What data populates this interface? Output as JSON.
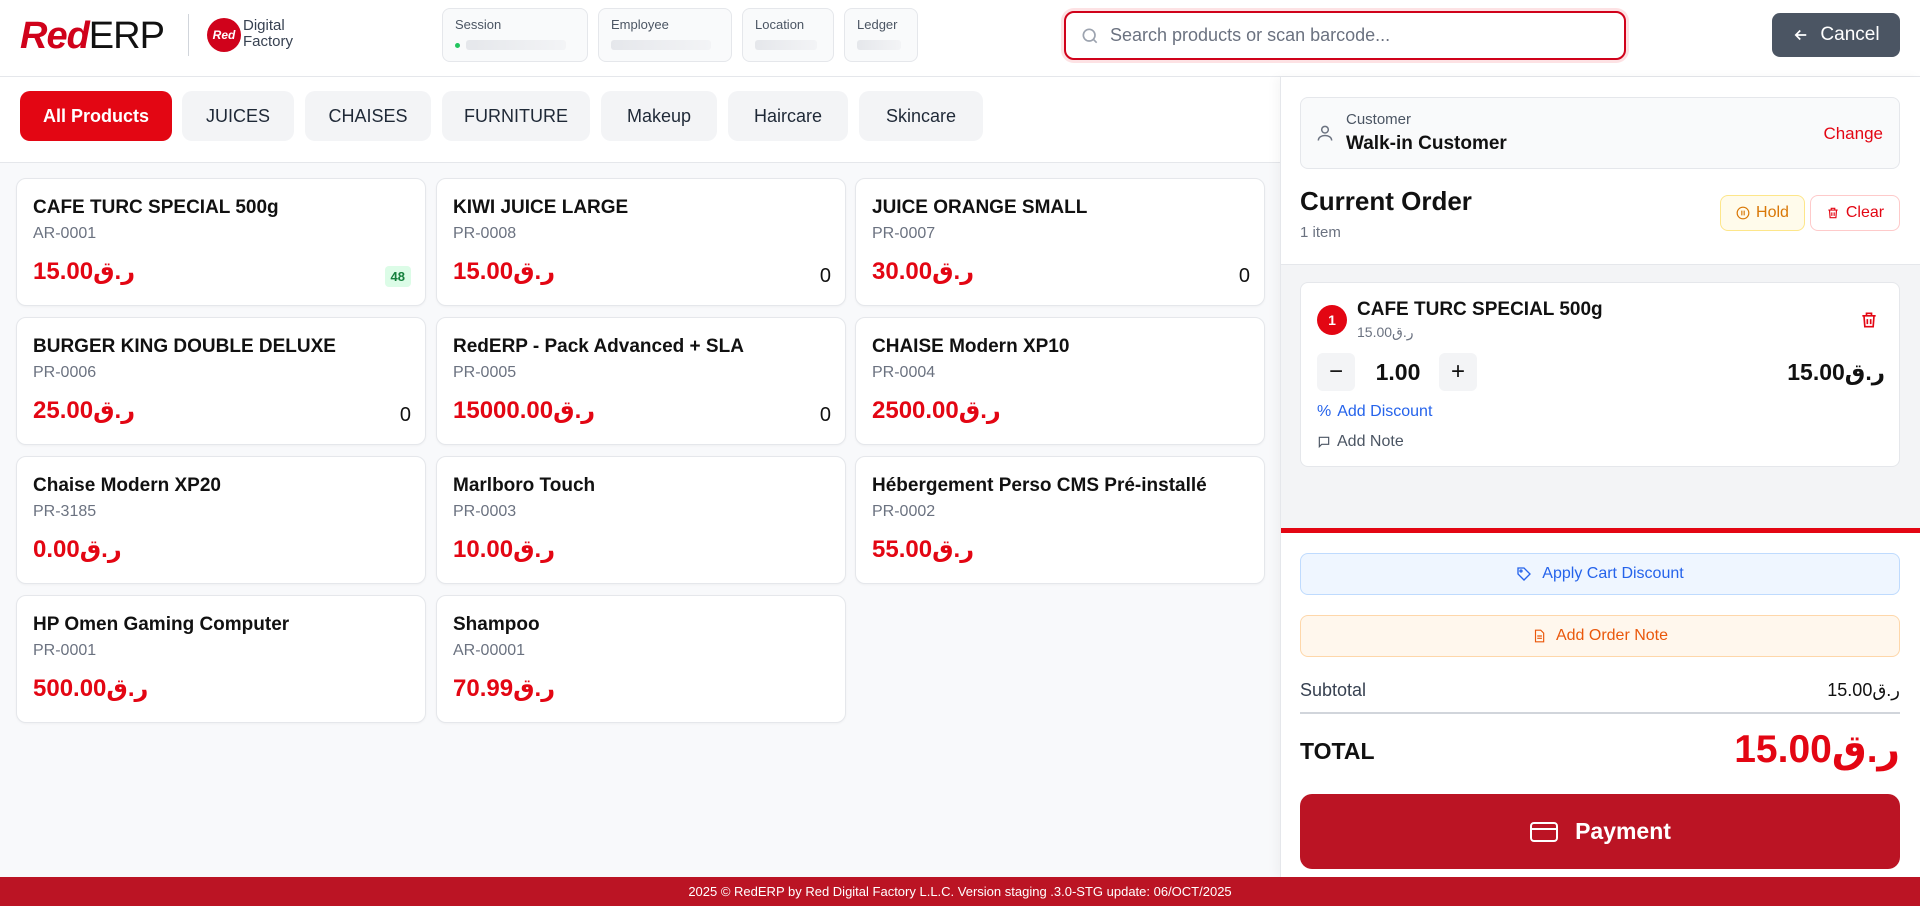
{
  "brand": {
    "logo_red": "Red",
    "logo_erp": "ERP",
    "partner_badge": "Red",
    "partner_line1": "Digital",
    "partner_line2": "Factory"
  },
  "header": {
    "session_label": "Session",
    "employee_label": "Employee",
    "location_label": "Location",
    "ledger_label": "Ledger",
    "search_placeholder": "Search products or scan barcode...",
    "cancel_label": "Cancel"
  },
  "categories": [
    "All Products",
    "JUICES",
    "CHAISES",
    "FURNITURE",
    "Makeup",
    "Haircare",
    "Skincare"
  ],
  "active_category": "All Products",
  "products": [
    {
      "name": "CAFE TURC SPECIAL 500g",
      "code": "AR-0001",
      "price": "15.00ر.ق",
      "stock": "48"
    },
    {
      "name": "KIWI JUICE LARGE",
      "code": "PR-0008",
      "price": "15.00ر.ق",
      "stock": "0"
    },
    {
      "name": "JUICE ORANGE SMALL",
      "code": "PR-0007",
      "price": "30.00ر.ق",
      "stock": "0"
    },
    {
      "name": "BURGER KING DOUBLE DELUXE",
      "code": "PR-0006",
      "price": "25.00ر.ق",
      "stock": "0"
    },
    {
      "name": "RedERP - Pack Advanced + SLA",
      "code": "PR-0005",
      "price": "15000.00ر.ق",
      "stock": "0"
    },
    {
      "name": "CHAISE Modern XP10",
      "code": "PR-0004",
      "price": "2500.00ر.ق",
      "stock": ""
    },
    {
      "name": "Chaise Modern XP20",
      "code": "PR-3185",
      "price": "0.00ر.ق",
      "stock": ""
    },
    {
      "name": "Marlboro Touch",
      "code": "PR-0003",
      "price": "10.00ر.ق",
      "stock": ""
    },
    {
      "name": "Hébergement Perso CMS Pré-installé",
      "code": "PR-0002",
      "price": "55.00ر.ق",
      "stock": ""
    },
    {
      "name": "HP Omen Gaming Computer",
      "code": "PR-0001",
      "price": "500.00ر.ق",
      "stock": ""
    },
    {
      "name": "Shampoo",
      "code": "AR-00001",
      "price": "70.99ر.ق",
      "stock": ""
    }
  ],
  "customer": {
    "label": "Customer",
    "name": "Walk-in Customer",
    "change_label": "Change"
  },
  "order": {
    "title": "Current Order",
    "count": "1 item",
    "hold_label": "Hold",
    "clear_label": "Clear",
    "items": [
      {
        "index": "1",
        "name": "CAFE TURC SPECIAL 500g",
        "unit_price": "15.00ر.ق",
        "quantity": "1.00",
        "line_total": "15.00ر.ق",
        "discount_label": "Add Discount",
        "note_label": "Add Note"
      }
    ],
    "cart_discount_label": "Apply Cart Discount",
    "order_note_label": "Add Order Note",
    "subtotal_label": "Subtotal",
    "subtotal": "15.00ر.ق",
    "total_label": "TOTAL",
    "total": "15.00ر.ق",
    "payment_label": "Payment"
  },
  "footer": {
    "text": "2025 © RedERP by Red Digital Factory L.L.C. Version staging .3.0-STG update: 06/OCT/2025"
  },
  "colors": {
    "accent": "#e30613",
    "dark_red": "#bb1424",
    "cancel_gray": "#4b5563",
    "stock_badge_bg": "#dcfce7"
  }
}
